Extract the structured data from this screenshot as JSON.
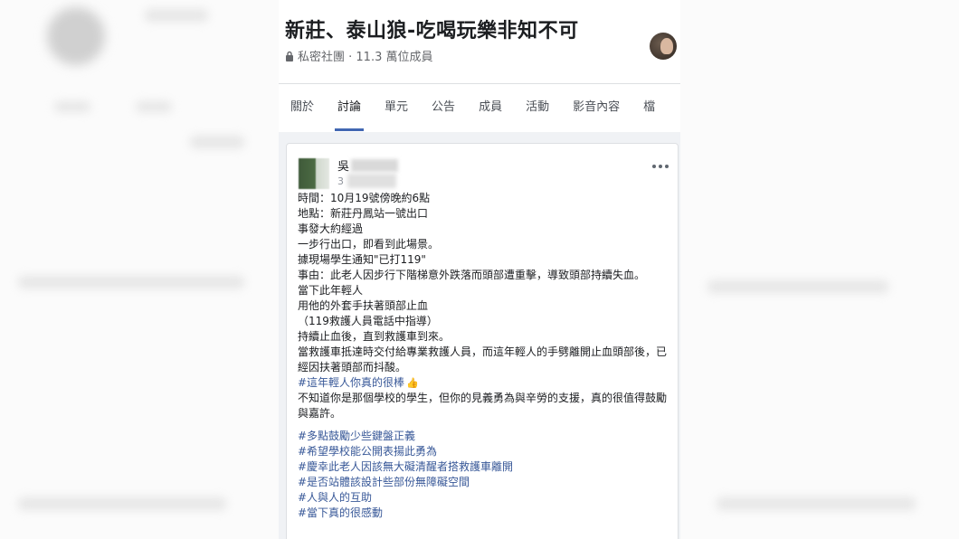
{
  "group": {
    "title": "新莊、泰山狼-吃喝玩樂非知不可",
    "meta": "私密社團 · 11.3 萬位成員"
  },
  "tabs": [
    {
      "label": "關於"
    },
    {
      "label": "討論"
    },
    {
      "label": "單元"
    },
    {
      "label": "公告"
    },
    {
      "label": "成員"
    },
    {
      "label": "活動"
    },
    {
      "label": "影音內容"
    },
    {
      "label": "檔"
    }
  ],
  "post": {
    "author_visible": "吳",
    "time_visible": "3",
    "lines": [
      "時間：10月19號傍晚約6點",
      "地點：新莊丹鳳站一號出口",
      "事發大約經過",
      "一步行出口，即看到此場景。",
      "據現場學生通知\"已打119\"",
      "事由：此老人因步行下階梯意外跌落而頭部遭重擊，導致頭部持續失血。",
      "當下此年輕人",
      "用他的外套手扶著頭部止血",
      "（119救護人員電話中指導）",
      "持續止血後，直到救護車到來。",
      "當救護車抵達時交付給專業救護人員，而這年輕人的手劈離開止血頭部後，已經因扶著頭部而抖酸。"
    ],
    "hashtag_inline": "#這年輕人你真的很棒",
    "closing": "不知道你是那個學校的學生，但你的見義勇為與辛勞的支援，真的很值得鼓勵與嘉許。",
    "hashtags": [
      "#多點鼓勵少些鍵盤正義",
      "#希望學校能公開表揚此勇為",
      "#慶幸此老人因該無大礙清醒者搭救護車離開",
      "#是否站體該設計些部份無障礙空間",
      "#人與人的互助",
      "#當下真的很感動"
    ]
  },
  "colors": {
    "accent": "#4267b2",
    "hashtag": "#385898"
  }
}
